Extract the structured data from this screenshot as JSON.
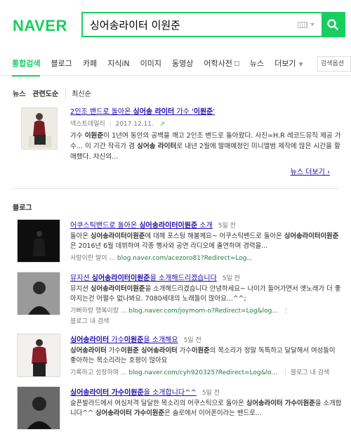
{
  "header": {
    "logo": "NAVER",
    "query": "싱어송라이터 이원준"
  },
  "tabs": [
    {
      "label": "통합검색",
      "active": true
    },
    {
      "label": "블로그"
    },
    {
      "label": "카페"
    },
    {
      "label": "지식iN"
    },
    {
      "label": "이미지"
    },
    {
      "label": "동영상"
    },
    {
      "label": "어학사전"
    },
    {
      "label": "뉴스"
    },
    {
      "label": "더보기"
    }
  ],
  "tab_options": "검색옵션",
  "news": {
    "subtabs": [
      "뉴스",
      "관련도순",
      "최신순"
    ],
    "item": {
      "title_pre": "2인조 밴드로 돌아온 ",
      "title_bold": "싱어송 라이터",
      "title_mid": " 가수 '",
      "title_bold2": "이원준",
      "title_post": "'",
      "source": "넥스트데일리",
      "date": "2017.12.11.",
      "snippet_parts": [
        "가수 ",
        "이원준",
        "이 1년여 동안의 공백을 깨고 2인조 밴드로 돌아왔다. 사진=H.R 레코드뮤직 제공 가수... 이 기간 작곡가 겸 ",
        "싱어송 라이터",
        "로 내년 2월에 발매예정인 미니앨범 제작에 많은 시간을 할애했다. 자신의..."
      ]
    },
    "more": "뉴스 더보기 ›"
  },
  "blog": {
    "heading": "블로그",
    "items": [
      {
        "title_pre": "어쿠스틱밴드로 돌아온 ",
        "title_bold": "싱어송라이터이원준",
        "title_post": " 소개",
        "date": "5일 전",
        "snippet_parts": [
          "돌아온 ",
          "싱어송라이터이원준",
          "에 대해 포스팅 해볼께요~ 어쿠스틱밴드로 돌아온 ",
          "싱어송라",
          "이터이원준",
          "은 2016년 6월 데뷔하여 각종 행사와 공연 라디오에 출연하며 경력을..."
        ],
        "author": "사랑이란 말이 ...",
        "url": "blog.naver.com/acezoro81?Redirect=Log...",
        "extra": ""
      },
      {
        "title_pre": "뮤지션 ",
        "title_bold": "싱어송라이터이원준",
        "title_post": "을 소개해드리겠습니다",
        "date": "5일 전",
        "snippet_parts": [
          "뮤지션 ",
          "싱어송라이터이원준",
          "을 소개해드리겠습니다 안녕하세요~ 나이가 들어가면서 옛노래가 더 좋아지는건 어쩔수 없나봐요. 7080세대의 노래들이 많아요...^^;"
        ],
        "author": "기뻐하랑 행복이랑 ...",
        "url": "blog.naver.com/joymom-o?Redirect=Log&log...",
        "extra": "블로그 내 검색"
      },
      {
        "title_pre": "",
        "title_bold": "싱어송라이터",
        "title_mid": " 가수",
        "title_bold2": "이원준",
        "title_post": "을 소개해요",
        "date": "5일 전",
        "snippet_parts": [
          "",
          "싱어송라이터",
          " 가수",
          "이원준",
          " ",
          "싱어송라이터",
          " 가수",
          "이원준",
          "의 목소리가 정말 독특하고 달달해서 여성들이 좋아하는 목소리라는 호평이 많아요 ",
          "싱어송라이터 가수이원준",
          "..."
        ],
        "author": "기록하고 성장하며 ...",
        "url": "blog.naver.com/cyh920325?Redirect=Log&lo...",
        "extra": "블로그 내 검색"
      },
      {
        "title_pre": "",
        "title_bold": "싱어송라이터 가수이원준",
        "title_post": "을 소개합니다^^",
        "date": "5일 전",
        "snippet_parts": [
          "슬픈발라드에서 여심저격 달달한 목소리의 어쿠스틱으로 돌아온 ",
          "싱어송라이터 가수이원준",
          "을 소개합니다^^ ",
          "싱어송라이터 가수이원준",
          "은 솔로에서 이어폰이라는 밴드로..."
        ],
        "author": "",
        "url": "",
        "extra": ""
      }
    ]
  }
}
